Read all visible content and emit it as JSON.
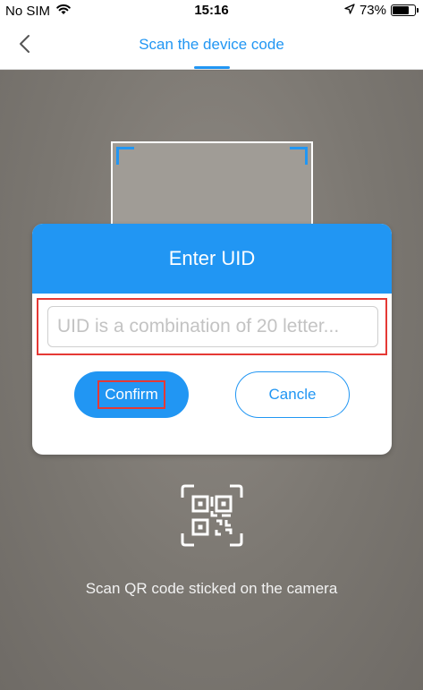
{
  "status_bar": {
    "carrier": "No SIM",
    "time": "15:16",
    "battery_percent": "73%",
    "battery_level": 0.73,
    "icons": [
      "wifi-icon",
      "location-arrow-icon",
      "battery-icon"
    ]
  },
  "nav": {
    "title": "Scan the device code",
    "back_icon": "chevron-left-icon"
  },
  "dialog": {
    "title": "Enter UID",
    "uid_placeholder": "UID is a combination of 20 letter...",
    "uid_value": "",
    "confirm_label": "Confirm",
    "cancel_label": "Cancle"
  },
  "scan": {
    "hint": "Scan QR code sticked on the camera",
    "icon": "qr-code-icon"
  },
  "colors": {
    "accent": "#2196f3",
    "highlight": "#e53935",
    "camera_bg": "#78736e"
  }
}
